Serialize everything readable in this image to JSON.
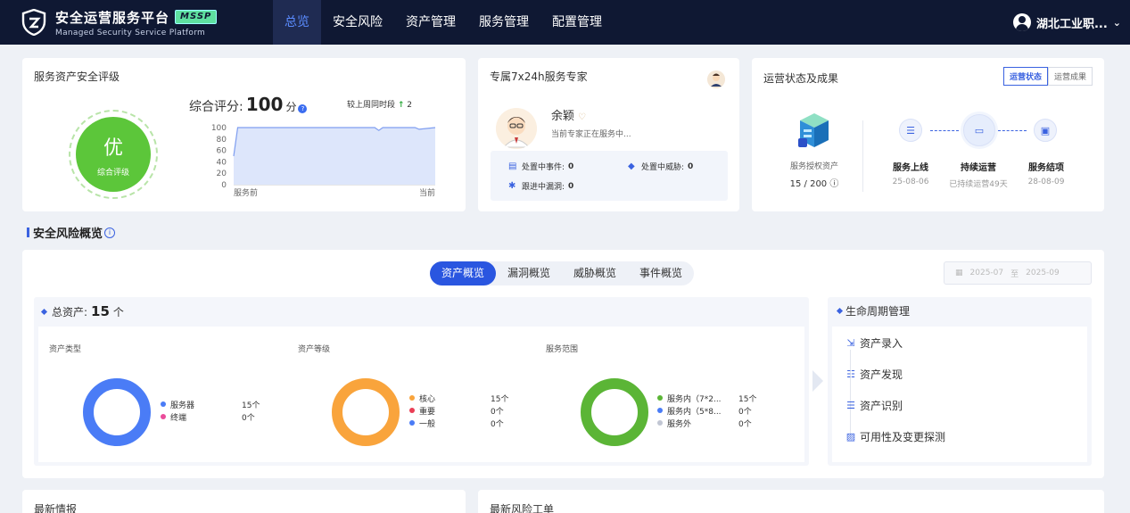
{
  "app": {
    "title": "安全运营服务平台",
    "badge": "MSSP",
    "subtitle": "Managed Security Service Platform"
  },
  "nav": [
    {
      "label": "总览",
      "active": true
    },
    {
      "label": "安全风险",
      "active": false
    },
    {
      "label": "资产管理",
      "active": false
    },
    {
      "label": "服务管理",
      "active": false
    },
    {
      "label": "配置管理",
      "active": false
    }
  ],
  "user": {
    "name": "湖北工业职...",
    "icon": "user-avatar-icon"
  },
  "rating": {
    "title": "服务资产安全评级",
    "grade": "优",
    "grade_label": "综合评级",
    "score_label": "综合评分:",
    "score": "100",
    "score_unit": "分",
    "compare_label": "较上周同时段",
    "compare_value": "2",
    "compare_arrow": "↑"
  },
  "chart_data": {
    "type": "area",
    "x": [
      "服务前",
      "当前"
    ],
    "yticks": [
      "100",
      "80",
      "60",
      "40",
      "20",
      "0"
    ],
    "ylim": [
      0,
      100
    ],
    "values": [
      [
        0,
        50
      ],
      [
        0.02,
        100
      ],
      [
        0.7,
        100
      ],
      [
        0.72,
        95
      ],
      [
        0.74,
        100
      ],
      [
        0.9,
        100
      ],
      [
        0.92,
        97
      ],
      [
        1,
        100
      ]
    ]
  },
  "expert": {
    "title": "专属7x24h服务专家",
    "name": "余颖",
    "status": "当前专家正在服务中...",
    "stats": {
      "events_label": "处置中事件:",
      "events_value": "0",
      "threats_label": "处置中威胁:",
      "threats_value": "0",
      "vulns_label": "跟进中漏洞:",
      "vulns_value": "0"
    }
  },
  "ops": {
    "title": "运营状态及成果",
    "tabs": [
      {
        "label": "运营状态",
        "active": true
      },
      {
        "label": "运营成果",
        "active": false
      }
    ],
    "asset_label": "服务授权资产",
    "asset_count": "15 / 200",
    "steps": [
      {
        "title": "服务上线",
        "sub": "25-08-06"
      },
      {
        "title": "持续运营",
        "sub": "已持续运营49天"
      },
      {
        "title": "服务结项",
        "sub": "28-08-09"
      }
    ]
  },
  "risk": {
    "section_title": "安全风险概览",
    "tabs": [
      {
        "label": "资产概览",
        "active": true
      },
      {
        "label": "漏洞概览",
        "active": false
      },
      {
        "label": "威胁概览",
        "active": false
      },
      {
        "label": "事件概览",
        "active": false
      }
    ],
    "date_from": "2025-07",
    "date_sep": "至",
    "date_to": "2025-09",
    "total_label": "总资产:",
    "total_value": "15",
    "total_unit": "个",
    "charts": [
      {
        "title": "资产类型",
        "items": [
          {
            "name": "服务器",
            "value": "15个",
            "color": "#4a7cf6",
            "num": 15
          },
          {
            "name": "终端",
            "value": "0个",
            "color": "#ea4c9a",
            "num": 0
          }
        ]
      },
      {
        "title": "资产等级",
        "items": [
          {
            "name": "核心",
            "value": "15个",
            "color": "#f9a43c",
            "num": 15
          },
          {
            "name": "重要",
            "value": "0个",
            "color": "#ea3e55",
            "num": 0
          },
          {
            "name": "一般",
            "value": "0个",
            "color": "#4a7cf6",
            "num": 0
          }
        ]
      },
      {
        "title": "服务范围",
        "items": [
          {
            "name": "服务内（7*2...",
            "value": "15个",
            "color": "#5bb536",
            "num": 15
          },
          {
            "name": "服务内（5*8...",
            "value": "0个",
            "color": "#4a7cf6",
            "num": 0
          },
          {
            "name": "服务外",
            "value": "0个",
            "color": "#c1c6d3",
            "num": 0
          }
        ]
      }
    ],
    "lifecycle": {
      "title": "生命周期管理",
      "items": [
        "资产录入",
        "资产发现",
        "资产识别",
        "可用性及变更探测"
      ]
    }
  },
  "bottom": {
    "left_title": "最新情报",
    "right_title": "最新风险工单"
  }
}
